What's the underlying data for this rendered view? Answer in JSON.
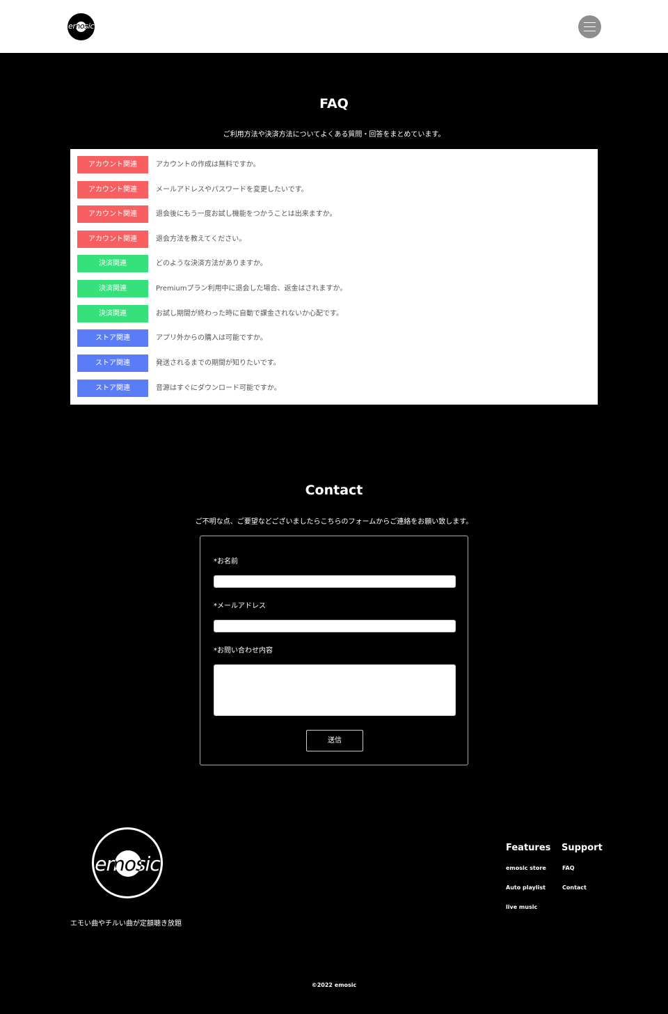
{
  "header": {
    "logo_text": "emosic",
    "menu_icon": "hamburger-icon"
  },
  "faq": {
    "title": "FAQ",
    "description": "ご利用方法や決済方法についてよくある質問・回答をまとめています。",
    "items": [
      {
        "tag": "アカウント関連",
        "question": "アカウントの作成は無料ですか。"
      },
      {
        "tag": "アカウント関連",
        "question": "メールアドレスやパスワードを変更したいです。"
      },
      {
        "tag": "アカウント関連",
        "question": "退会後にもう一度お試し機能をつかうことは出来ますか。"
      },
      {
        "tag": "アカウント関連",
        "question": "退会方法を教えてください。"
      },
      {
        "tag": "決済関連",
        "question": "どのような決済方法がありますか。"
      },
      {
        "tag": "決済関連",
        "question": "Premiumプラン利用中に退会した場合、返金はされますか。"
      },
      {
        "tag": "決済関連",
        "question": "お試し期間が終わった時に自動で課金されないか心配です。"
      },
      {
        "tag": "ストア関連",
        "question": "アプリ外からの購入は可能ですか。"
      },
      {
        "tag": "ストア関連",
        "question": "発送されるまでの期間が知りたいです。"
      },
      {
        "tag": "ストア関連",
        "question": "音源はすぐにダウンロード可能ですか。"
      }
    ],
    "tag_colors": {
      "account": "#f85f60",
      "payment": "#36e07a",
      "store": "#5a7cf6"
    }
  },
  "contact": {
    "title": "Contact",
    "description": "ご不明な点、ご要望などございましたらこちらのフォームからご連絡をお願い致します。",
    "name_label": "*お名前",
    "name_value": "",
    "email_label": "*メールアドレス",
    "email_value": "",
    "message_label": "*お問い合わせ内容",
    "message_value": "",
    "submit_label": "送信"
  },
  "footer": {
    "logo_text": "emosic",
    "tagline": "エモい曲やチルい曲が定額聴き放題",
    "features_heading": "Features",
    "features_links": [
      "emosic store",
      "Auto playlist",
      "live music"
    ],
    "support_heading": "Support",
    "support_links": [
      "FAQ",
      "Contact"
    ],
    "copyright": "©2022 emosic"
  }
}
